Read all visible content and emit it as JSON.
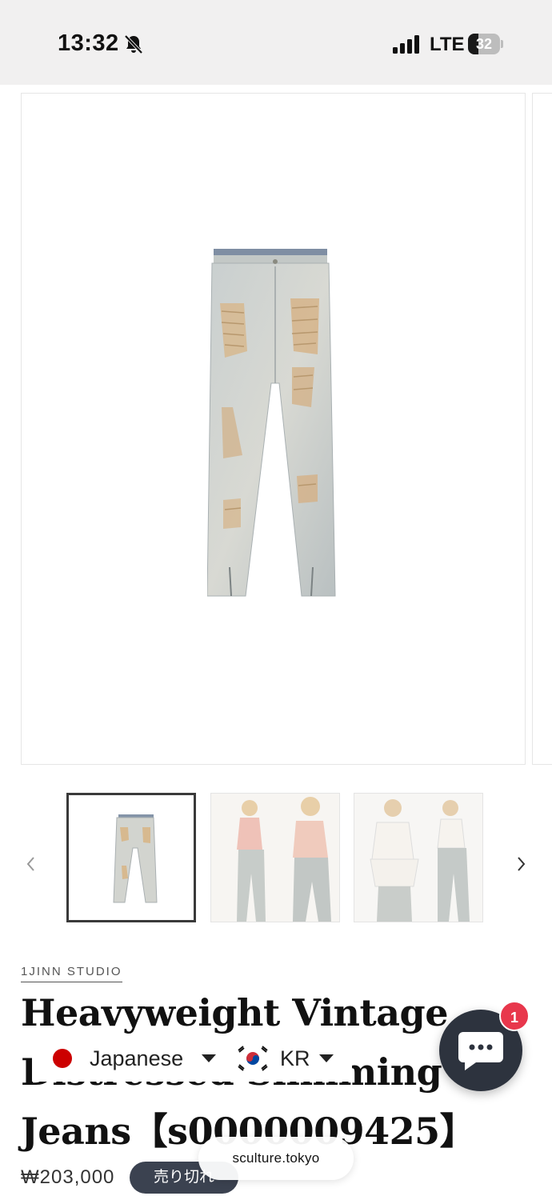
{
  "status_bar": {
    "time": "13:32",
    "network": "LTE",
    "battery_level": "32",
    "battery_fraction": 0.32
  },
  "gallery": {
    "main_image": "distressed-light-wash-jeans",
    "thumbnails": [
      "jeans-product-photo",
      "model-pink-corset-outfit",
      "model-white-corset-outfit"
    ],
    "selected_index": 0
  },
  "product": {
    "vendor": "1JINN STUDIO",
    "title_line1": "Heavyweight Vintage",
    "title_line2": "Distressed Slimming",
    "title_line3": "Jeans【s0000009425】",
    "price": "₩203,000",
    "sold_out_label": "売り切れ"
  },
  "locale": {
    "language": "Japanese",
    "currency": "KR"
  },
  "chat": {
    "badge_count": "1"
  },
  "browser": {
    "url": "sculture.tokyo"
  },
  "colors": {
    "status_bg": "#f1f0f0",
    "soldout_bg": "#3b4250",
    "chat_bg": "#2d333e",
    "badge_bg": "#e8374c"
  }
}
